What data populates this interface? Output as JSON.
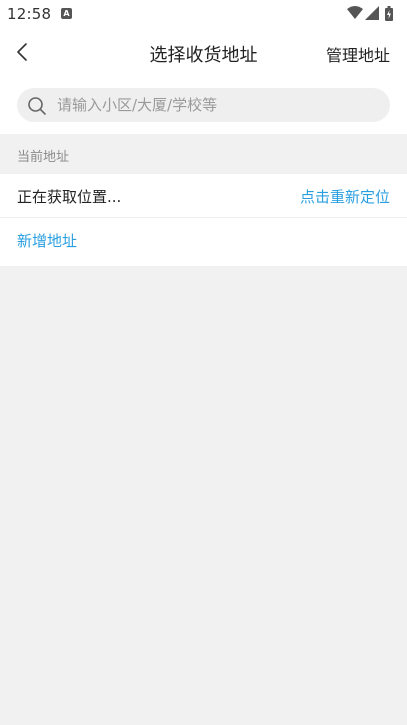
{
  "status_bar": {
    "time": "12:58",
    "notification_badge": "A",
    "icons": [
      "wifi-icon",
      "signal-icon",
      "battery-icon"
    ]
  },
  "header": {
    "back_icon": "chevron-left-icon",
    "title": "选择收货地址",
    "manage_label": "管理地址"
  },
  "search": {
    "icon": "search-icon",
    "placeholder": "请输入小区/大厦/学校等",
    "value": ""
  },
  "current_address": {
    "section_title": "当前地址",
    "status_text": "正在获取位置...",
    "relocate_label": "点击重新定位"
  },
  "add_address": {
    "label": "新增地址"
  },
  "colors": {
    "accent": "#2a9fe0",
    "background": "#f1f1f1",
    "surface": "#ffffff"
  }
}
